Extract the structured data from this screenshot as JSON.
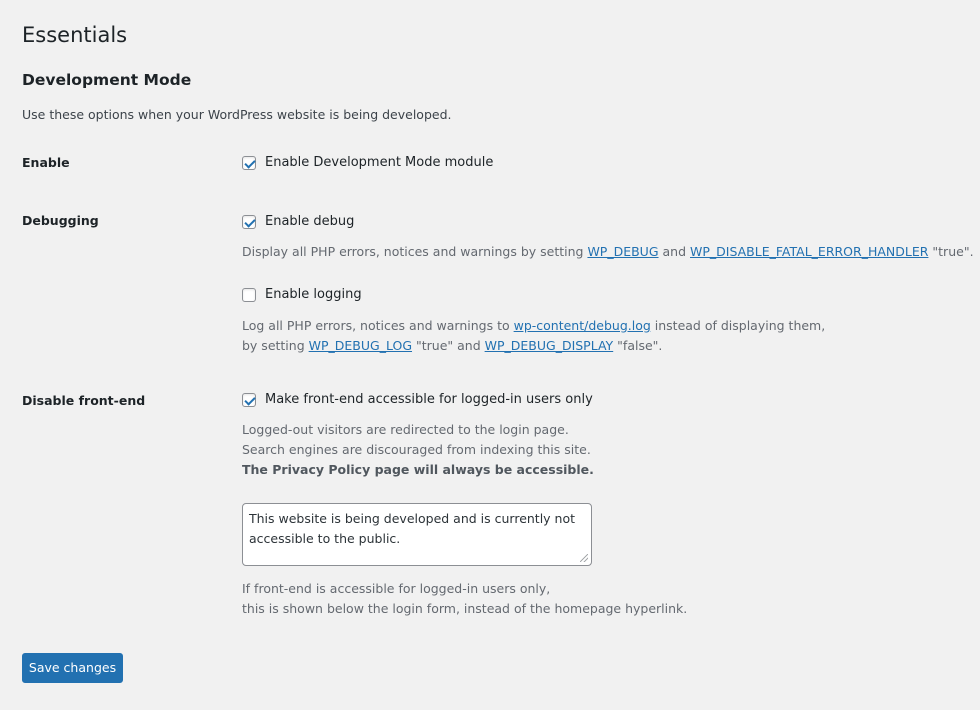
{
  "page": {
    "title": "Essentials",
    "section_title": "Development Mode",
    "intro": "Use these options when your WordPress website is being developed."
  },
  "enable": {
    "label": "Enable",
    "checkbox_label": "Enable Development Mode module",
    "checked": true
  },
  "debugging": {
    "label": "Debugging",
    "debug_checkbox_label": "Enable debug",
    "debug_checked": true,
    "debug_desc_prefix": "Display all PHP errors, notices and warnings by setting ",
    "debug_link1": "WP_DEBUG",
    "debug_desc_and": " and ",
    "debug_link2": "WP_DISABLE_FATAL_ERROR_HANDLER",
    "debug_desc_suffix": " \"true\".",
    "logging_checkbox_label": "Enable logging",
    "logging_checked": false,
    "log_desc_prefix": "Log all PHP errors, notices and warnings to ",
    "log_link_file": "wp-content/debug.log",
    "log_desc_mid": " instead of displaying them,",
    "log_desc2_prefix": "by setting ",
    "log_link1": "WP_DEBUG_LOG",
    "log_desc2_mid": " \"true\" and ",
    "log_link2": "WP_DEBUG_DISPLAY",
    "log_desc2_suffix": " \"false\"."
  },
  "frontend": {
    "label": "Disable front-end",
    "checkbox_label": "Make front-end accessible for logged-in users only",
    "checked": true,
    "desc_line1": "Logged-out visitors are redirected to the login page.",
    "desc_line2": "Search engines are discouraged from indexing this site.",
    "desc_line3": "The Privacy Policy page will always be accessible.",
    "message_value": "This website is being developed and is currently not accessible to the public.",
    "note_line1": "If front-end is accessible for logged-in users only,",
    "note_line2": "this is shown below the login form, instead of the homepage hyperlink."
  },
  "actions": {
    "save_label": "Save changes"
  },
  "colors": {
    "background": "#f1f1f1",
    "accent": "#2271b1",
    "link": "#2271b1"
  }
}
